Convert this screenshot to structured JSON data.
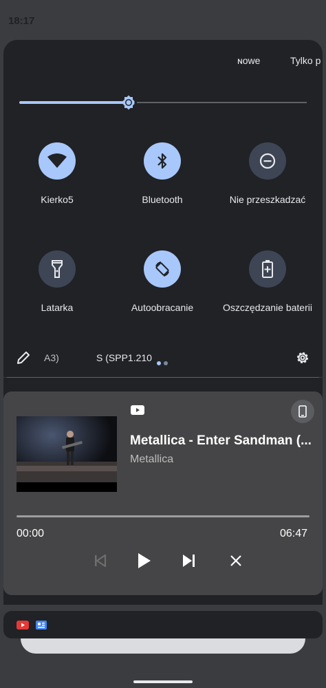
{
  "status": {
    "time": "18:17"
  },
  "quick_settings": {
    "header_texts": [
      "ɴowe",
      "Tylko p"
    ],
    "brightness": {
      "level": 0.38
    },
    "tiles": [
      {
        "id": "wifi",
        "label": "Kierko5",
        "icon": "wifi-icon",
        "state": "on"
      },
      {
        "id": "bluetooth",
        "label": "Bluetooth",
        "icon": "bluetooth-icon",
        "state": "on"
      },
      {
        "id": "dnd",
        "label": "Nie przeszkadzać",
        "icon": "do-not-disturb-icon",
        "state": "off"
      },
      {
        "id": "flashlight",
        "label": "Latarka",
        "icon": "flashlight-icon",
        "state": "off"
      },
      {
        "id": "autorotate",
        "label": "Autoobracanie",
        "icon": "auto-rotate-icon",
        "state": "on"
      },
      {
        "id": "battery_saver",
        "label": "Oszczędzanie baterii",
        "icon": "battery-saver-icon",
        "state": "off"
      }
    ],
    "footer": {
      "build_left": "A3)",
      "build_right": "S (SPP1.210",
      "page_count": 2,
      "active_page": 0
    }
  },
  "media": {
    "app_icon": "youtube-icon",
    "title": "Metallica - Enter Sandman (...",
    "artist": "Metallica",
    "elapsed": "00:00",
    "duration": "06:47",
    "progress": 0.0,
    "controls": [
      "previous-icon",
      "play-icon",
      "next-icon",
      "close-icon"
    ]
  },
  "notifications": {
    "icons": [
      "youtube-icon",
      "google-news-icon"
    ]
  },
  "colors": {
    "accent": "#a8c7fa",
    "tile_off": "#3e4554",
    "shade_bg": "#202226",
    "media_bg": "#454547"
  }
}
